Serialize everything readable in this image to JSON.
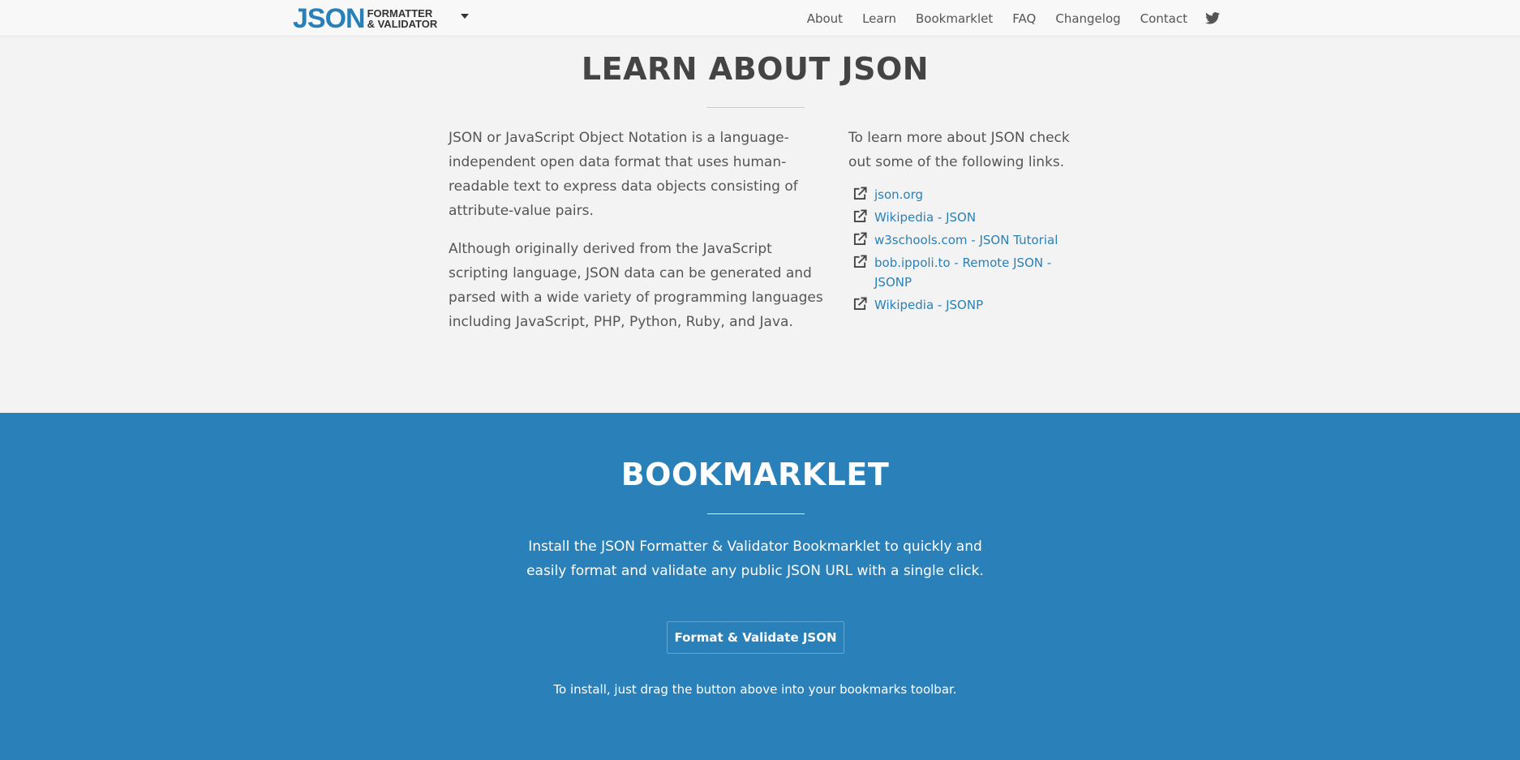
{
  "header": {
    "brand": {
      "json": "JSON",
      "line1": "FORMATTER",
      "line2": "& VALIDATOR"
    },
    "nav": [
      "About",
      "Learn",
      "Bookmarklet",
      "FAQ",
      "Changelog",
      "Contact"
    ]
  },
  "learn": {
    "title": "LEARN ABOUT JSON",
    "paragraph1": "JSON or JavaScript Object Notation is a language-independent open data format that uses human-readable text to express data objects consisting of attribute-value pairs.",
    "paragraph2": "Although originally derived from the JavaScript scripting language, JSON data can be generated and parsed with a wide variety of programming languages including JavaScript, PHP, Python, Ruby, and Java.",
    "links_intro": "To learn more about JSON check out some of the following links.",
    "links": [
      "json.org",
      "Wikipedia - JSON",
      "w3schools.com - JSON Tutorial",
      "bob.ippoli.to - Remote JSON - JSONP",
      "Wikipedia - JSONP"
    ]
  },
  "bookmarklet": {
    "title": "BOOKMARKLET",
    "description": "Install the JSON Formatter & Validator Bookmarklet to quickly and easily format and validate any public JSON URL with a single click.",
    "button": "Format & Validate JSON",
    "hint": "To install, just drag the button above into your bookmarks toolbar."
  },
  "colors": {
    "accent": "#2980b9",
    "band": "#2a80b9",
    "page_bg": "#f3f3f3",
    "heading": "#444444"
  },
  "icons": [
    "caret-down-icon",
    "twitter-icon",
    "external-link-icon"
  ]
}
